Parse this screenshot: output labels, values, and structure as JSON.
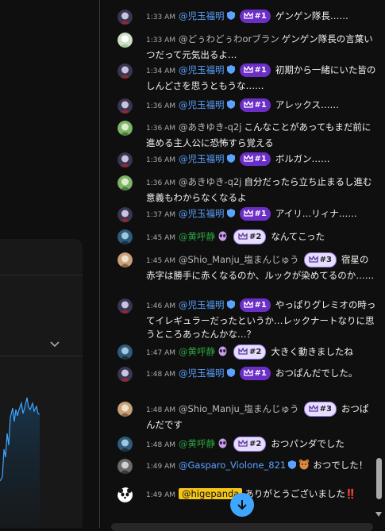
{
  "messages": [
    {
      "time": "1:33 AM",
      "author": "@児玉福明",
      "verified": true,
      "badge": "#1",
      "badge_style": "purple",
      "text": "ゲンゲン隊長……",
      "avatar": "anime-avatar"
    },
    {
      "time": "1:33 AM",
      "author": "@どぅわどぅわorブラン",
      "verified": false,
      "badge": "",
      "text": "ゲンゲン隊長の言葉いつだって元気出るよ…",
      "avatar": "bunny-avatar"
    },
    {
      "time": "1:34 AM",
      "author": "@児玉福明",
      "verified": true,
      "badge": "#1",
      "badge_style": "purple",
      "text": "初期から一緒にいた皆のしんどさを思うともうな……",
      "avatar": "anime-avatar"
    },
    {
      "time": "1:36 AM",
      "author": "@児玉福明",
      "verified": true,
      "badge": "#1",
      "badge_style": "purple",
      "text": "アレックス……",
      "avatar": "anime-avatar"
    },
    {
      "time": "1:36 AM",
      "author": "@あきゆき-q2j",
      "verified": false,
      "badge": "",
      "text": "こんなことがあってもまだ前に進める主人公に恐怖すら覚える",
      "avatar": "green-avatar"
    },
    {
      "time": "1:36 AM",
      "author": "@児玉福明",
      "verified": true,
      "badge": "#1",
      "badge_style": "purple",
      "text": "ボルガン……",
      "avatar": "anime-avatar"
    },
    {
      "time": "1:36 AM",
      "author": "@あきゆき-q2j",
      "verified": false,
      "badge": "",
      "text": "自分だったら立ち止まるし進む意義もわからなくなるよ",
      "avatar": "green-avatar"
    },
    {
      "time": "1:37 AM",
      "author": "@児玉福明",
      "verified": true,
      "badge": "#1",
      "badge_style": "purple",
      "text": "アイリ…リィナ……",
      "avatar": "anime-avatar"
    },
    {
      "time": "1:45 AM",
      "author": "@黄呼静",
      "verified": false,
      "emoji": "alien",
      "badge": "#2",
      "badge_style": "light",
      "text": "なんてこった",
      "avatar": "blue-avatar"
    },
    {
      "time": "1:45 AM",
      "author": "@Shio_Manju_塩まんじゅう",
      "verified": false,
      "badge": "#3",
      "badge_style": "light",
      "text": "宿星の赤字は勝手に赤くなるのか、ルックが染めてるのか……",
      "avatar": "manju-avatar"
    },
    {
      "time": "1:46 AM",
      "author": "@児玉福明",
      "verified": true,
      "badge": "#1",
      "badge_style": "purple",
      "text": "やっぱりグレミオの時ってイレギュラーだったというか…レックナートなりに思うところあったんかな…？",
      "avatar": "anime-avatar"
    },
    {
      "time": "1:47 AM",
      "author": "@黄呼静",
      "verified": false,
      "emoji": "alien",
      "badge": "#2",
      "badge_style": "light",
      "text": "大きく動きましたね",
      "avatar": "blue-avatar"
    },
    {
      "time": "1:48 AM",
      "author": "@児玉福明",
      "verified": true,
      "badge": "#1",
      "badge_style": "purple",
      "text": "おつぱんだでした。",
      "avatar": "anime-avatar"
    },
    {
      "time": "1:48 AM",
      "author": "@Shio_Manju_塩まんじゅう",
      "verified": false,
      "badge": "#3",
      "badge_style": "light",
      "text": "おつぱんだです",
      "avatar": "manju-avatar"
    },
    {
      "time": "1:48 AM",
      "author": "@黄呼静",
      "verified": false,
      "emoji": "alien",
      "badge": "#2",
      "badge_style": "light",
      "text": "おつパンダでした",
      "avatar": "blue-avatar"
    },
    {
      "time": "1:49 AM",
      "author": "@Gasparo_Violone_821",
      "verified": true,
      "emoji": "bear",
      "badge": "",
      "text": "おつでした！",
      "avatar": "gray-avatar"
    },
    {
      "time": "1:49 AM",
      "author": "@higepanda",
      "verified": false,
      "owner": true,
      "badge": "",
      "text": "ありがとうございました‼️",
      "avatar": "panda-avatar"
    }
  ],
  "colors": {
    "background": "#0f0f0f",
    "member_blue": "#5aa2ff",
    "member_green": "#2ba640",
    "badge_purple": "#6b2fc7",
    "owner_highlight": "#f5c518",
    "jump_button": "#3ea6ff"
  },
  "icons": [
    "verified-shield-icon",
    "crown-icon",
    "chevron-down-icon",
    "arrow-down-icon",
    "alien-emoji-icon",
    "bear-emoji-icon",
    "double-exclamation-icon"
  ]
}
